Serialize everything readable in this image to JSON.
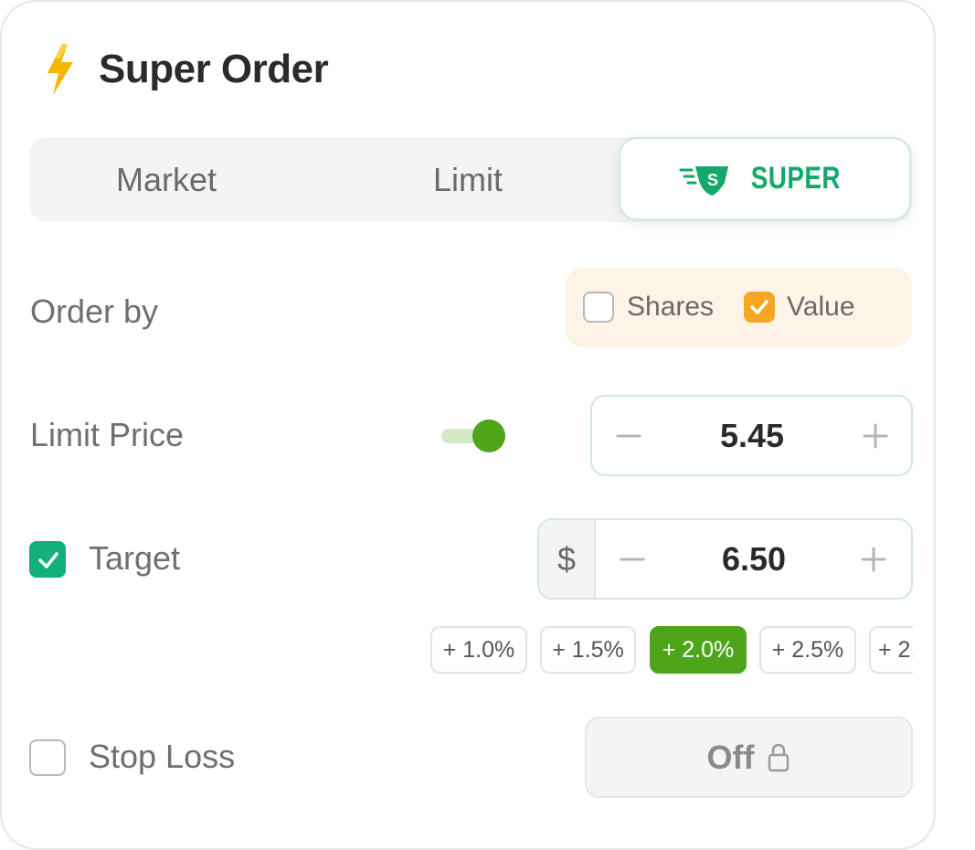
{
  "header": {
    "title": "Super Order",
    "icon": "lightning-bolt-icon"
  },
  "tabs": [
    {
      "label": "Market",
      "selected": false
    },
    {
      "label": "Limit",
      "selected": false
    },
    {
      "label": "SUPER",
      "selected": true,
      "icon": "super-s-badge-icon"
    }
  ],
  "order_by": {
    "label": "Order by",
    "options": [
      {
        "label": "Shares",
        "checked": false
      },
      {
        "label": "Value",
        "checked": true
      }
    ]
  },
  "limit_price": {
    "label": "Limit Price",
    "toggle_on": true,
    "value": "5.45"
  },
  "target": {
    "label": "Target",
    "checked": true,
    "currency": "$",
    "value": "6.50",
    "presets": [
      "+ 1.0%",
      "+ 1.5%",
      "+ 2.0%",
      "+ 2.5%",
      "+ 2."
    ],
    "active_preset": "+ 2.0%"
  },
  "stop_loss": {
    "label": "Stop Loss",
    "checked": false,
    "button_label": "Off",
    "icon": "lock-icon"
  },
  "colors": {
    "accent_green": "#12b07a",
    "active_chip": "#4ea51a",
    "orange": "#f5a623",
    "super_text": "#14a86b"
  }
}
